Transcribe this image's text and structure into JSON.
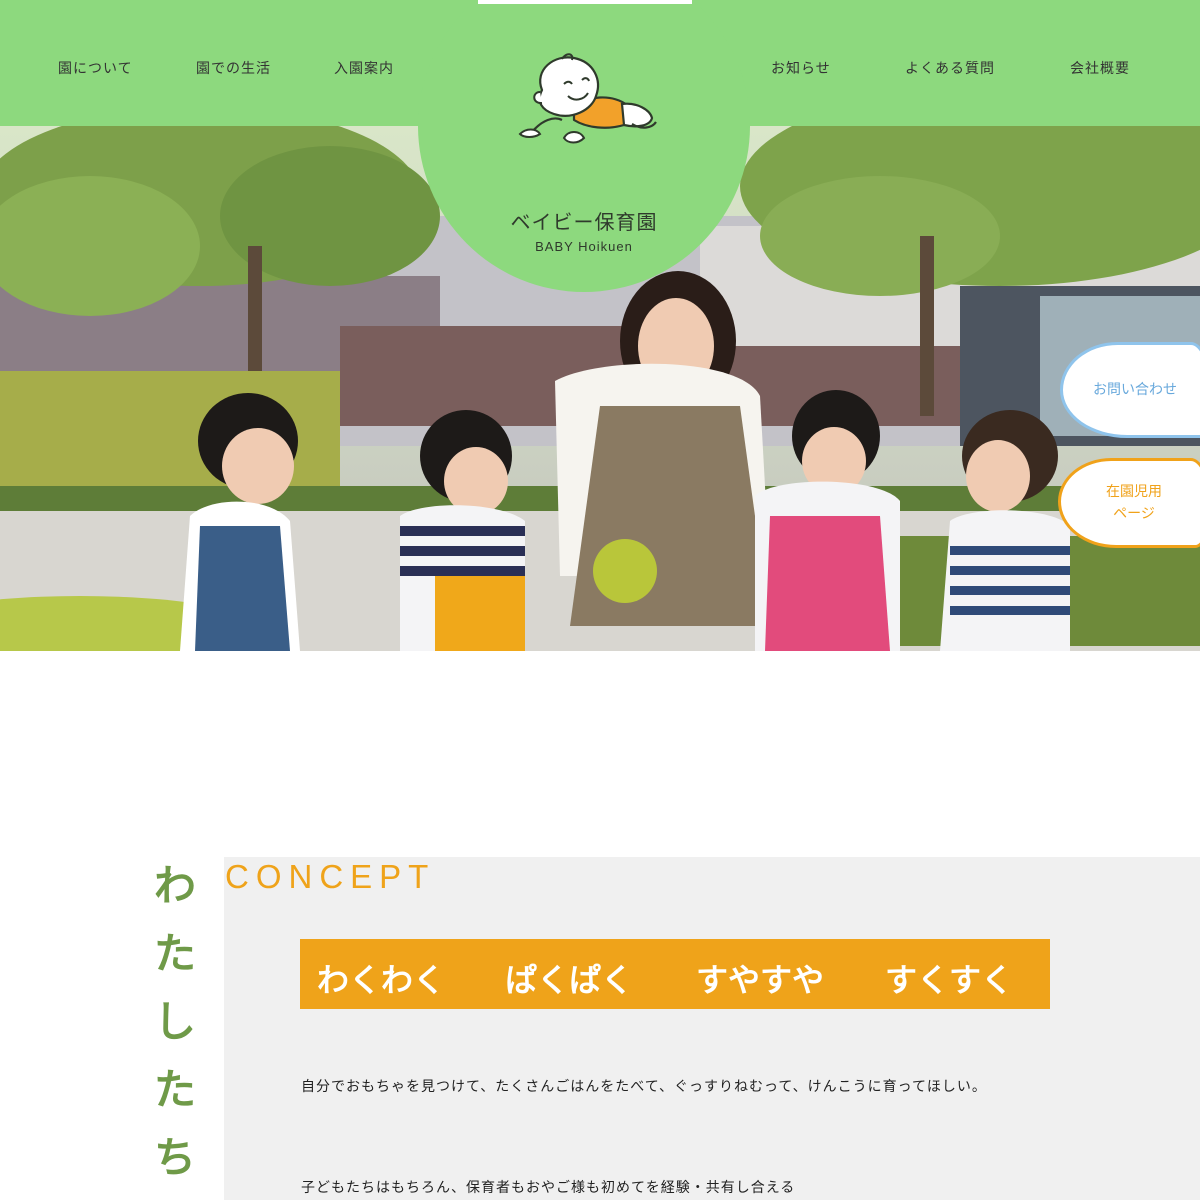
{
  "header": {
    "nav_left": [
      "園について",
      "園での生活",
      "入園案内"
    ],
    "nav_right": [
      "お知らせ",
      "よくある質問",
      "会社概要"
    ],
    "logo_name": "ベイビー保育園",
    "logo_sub": "BABY Hoikuen",
    "logo_icon": "baby-crawling-icon"
  },
  "float_buttons": {
    "contact": "お問い合わせ",
    "member_line1": "在園児用",
    "member_line2": "ページ"
  },
  "concept": {
    "vertical_title": [
      "わ",
      "た",
      "し",
      "た",
      "ち"
    ],
    "label": "CONCEPT",
    "banner": [
      "わくわく",
      "ぱくぱく",
      "すやすや",
      "すくすく"
    ],
    "text1": "自分でおもちゃを見つけて、たくさんごはんをたべて、ぐっすりねむって、けんこうに育ってほしい。",
    "text2": "子どもたちはもちろん、保育者もおやご様も初めてを経験・共有し合える"
  },
  "colors": {
    "header_green": "#8dd97e",
    "accent_orange": "#efa31a",
    "title_green": "#6f9a48",
    "contact_blue": "#8fc4ec"
  }
}
